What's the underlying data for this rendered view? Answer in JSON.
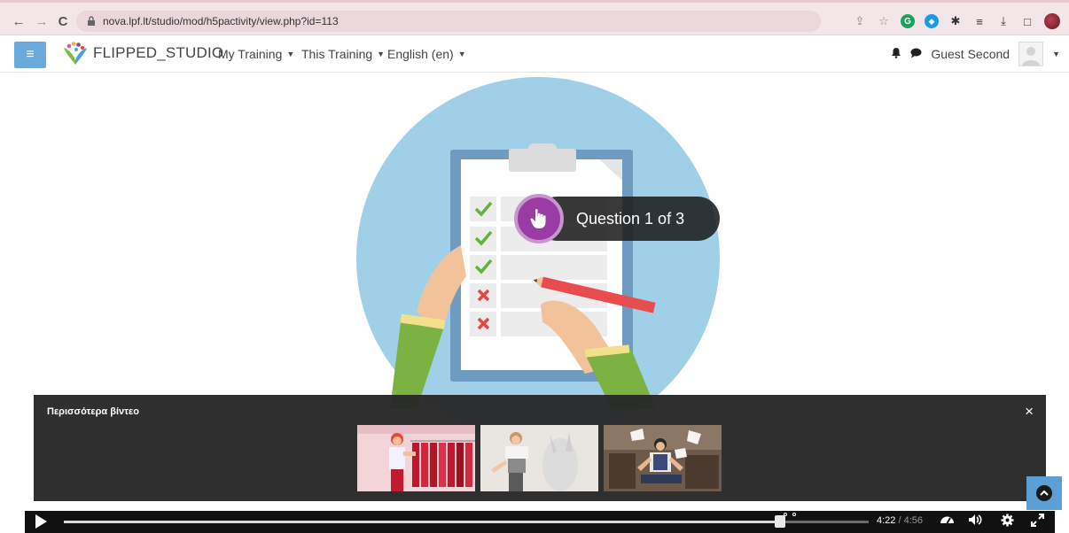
{
  "browser": {
    "back_icon": "←",
    "forward_icon": "→",
    "reload_icon": "C",
    "url": "nova.lpf.lt/studio/mod/h5pactivity/view.php?id=113"
  },
  "site": {
    "name": "FLIPPED_STUDIO",
    "menu": [
      {
        "label": "My Training"
      },
      {
        "label": "This Training"
      },
      {
        "label": "English (en)"
      }
    ],
    "user_name": "Guest Second"
  },
  "video": {
    "question_label": "Question 1 of 3",
    "more_videos_title": "Περισσότερα βίντεο",
    "close_symbol": "×",
    "current_time": "4:22",
    "separator": " / ",
    "duration": "4:56",
    "progress": 0.89
  },
  "colors": {
    "accent_blue": "#6aa9d9",
    "question_purple": "#9b3ba6",
    "circle_blue": "#9fd0e8"
  }
}
